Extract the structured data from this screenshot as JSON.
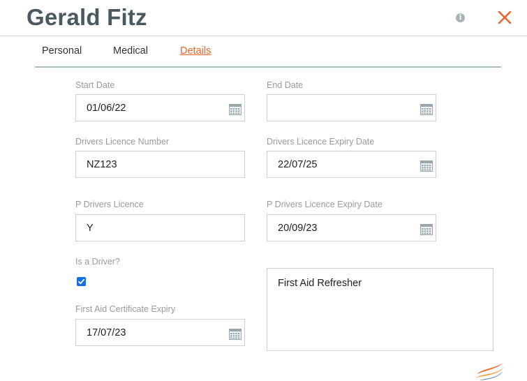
{
  "header": {
    "title": "Gerald Fitz",
    "info_icon": "info-icon",
    "close_icon": "close-icon",
    "accent_color": "#e8662a"
  },
  "tabs": [
    {
      "label": "Personal",
      "active": false
    },
    {
      "label": "Medical",
      "active": false
    },
    {
      "label": "Details",
      "active": true
    }
  ],
  "form": {
    "start_date": {
      "label": "Start Date",
      "value": "01/06/22",
      "icon": "calendar-icon"
    },
    "end_date": {
      "label": "End Date",
      "value": "",
      "icon": "calendar-icon"
    },
    "licence_number": {
      "label": "Drivers Licence Number",
      "value": "NZ123"
    },
    "licence_expiry": {
      "label": "Drivers Licence Expiry Date",
      "value": "22/07/25",
      "icon": "calendar-icon"
    },
    "p_licence": {
      "label": "P Drivers Licence",
      "value": "Y"
    },
    "p_licence_expiry": {
      "label": "P Drivers Licence Expiry Date",
      "value": "20/09/23",
      "icon": "calendar-icon"
    },
    "is_driver": {
      "label": "Is a Driver?",
      "checked": true
    },
    "first_aid_expiry": {
      "label": "First Aid Certificate Expiry",
      "value": "17/07/23",
      "icon": "calendar-icon"
    },
    "notes": {
      "value": "First Aid Refresher"
    }
  }
}
